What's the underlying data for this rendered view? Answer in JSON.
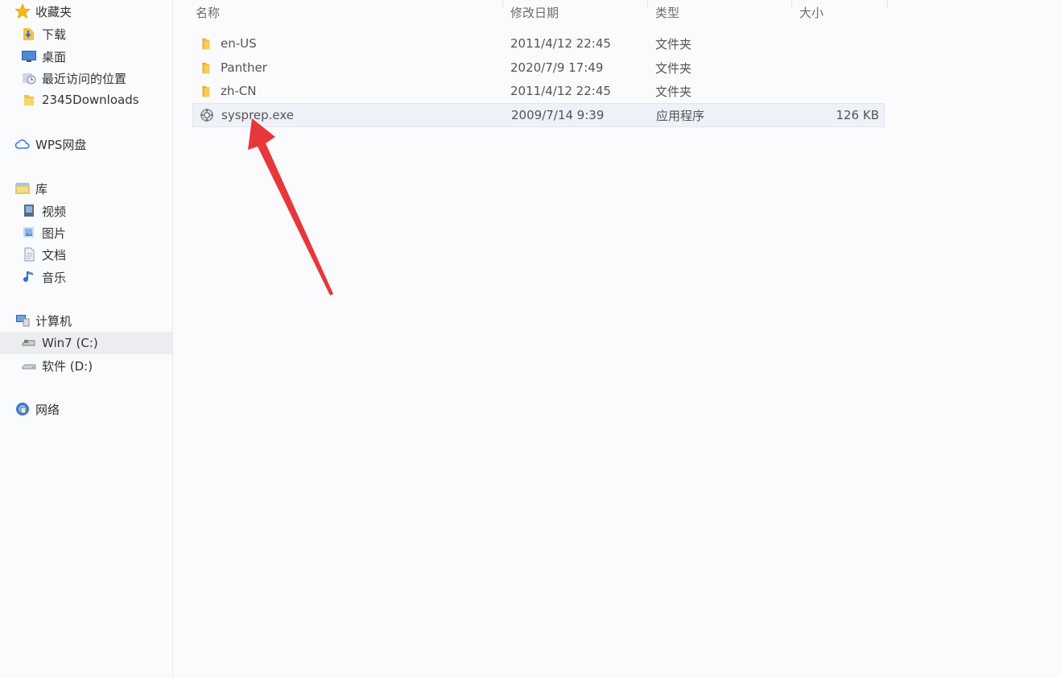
{
  "nav": {
    "favorites": {
      "label": "收藏夹",
      "icon": "star-icon"
    },
    "favorite_items": [
      {
        "label": "下载",
        "icon": "download-folder-icon"
      },
      {
        "label": "桌面",
        "icon": "desktop-icon"
      },
      {
        "label": "最近访问的位置",
        "icon": "recent-places-icon"
      },
      {
        "label": "2345Downloads",
        "icon": "folder-icon"
      }
    ],
    "cloud": {
      "label": "WPS网盘",
      "icon": "cloud-icon"
    },
    "libraries": {
      "label": "库",
      "icon": "library-icon"
    },
    "library_items": [
      {
        "label": "视频",
        "icon": "video-icon"
      },
      {
        "label": "图片",
        "icon": "picture-icon"
      },
      {
        "label": "文档",
        "icon": "document-icon"
      },
      {
        "label": "音乐",
        "icon": "music-icon"
      }
    ],
    "computer": {
      "label": "计算机",
      "icon": "computer-icon"
    },
    "drives": [
      {
        "label": "Win7 (C:)",
        "icon": "system-drive-icon",
        "selected": true
      },
      {
        "label": "软件 (D:)",
        "icon": "drive-icon",
        "selected": false
      }
    ],
    "network": {
      "label": "网络",
      "icon": "network-icon"
    }
  },
  "columns": {
    "name": "名称",
    "date": "修改日期",
    "type": "类型",
    "size": "大小"
  },
  "files": [
    {
      "name": "en-US",
      "date": "2011/4/12 22:45",
      "type": "文件夹",
      "size": "",
      "icon": "folder-icon"
    },
    {
      "name": "Panther",
      "date": "2020/7/9 17:49",
      "type": "文件夹",
      "size": "",
      "icon": "folder-icon"
    },
    {
      "name": "zh-CN",
      "date": "2011/4/12 22:45",
      "type": "文件夹",
      "size": "",
      "icon": "folder-icon"
    },
    {
      "name": "sysprep.exe",
      "date": "2009/7/14 9:39",
      "type": "应用程序",
      "size": "126 KB",
      "icon": "application-icon",
      "highlighted": true
    }
  ],
  "colors": {
    "arrow": "#e8373a",
    "folder": "#f1c24a",
    "selection": "#eef1f8"
  }
}
